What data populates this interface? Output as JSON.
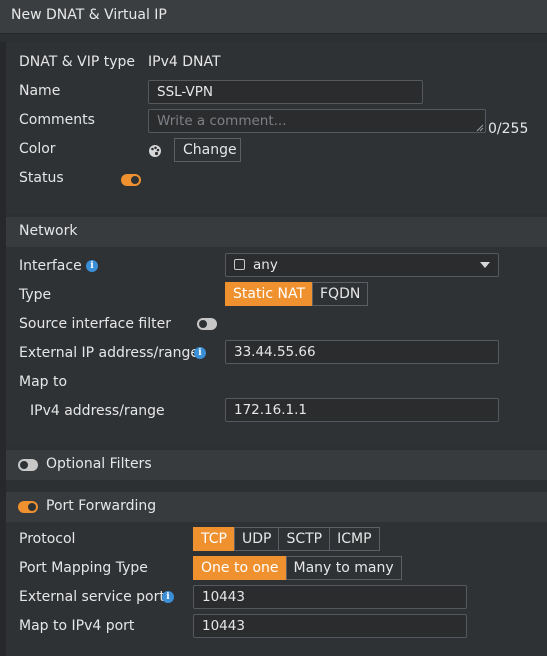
{
  "dialog": {
    "title": "New DNAT & Virtual IP"
  },
  "general": {
    "type_label": "DNAT & VIP type",
    "type_value": "IPv4 DNAT",
    "name_label": "Name",
    "name_value": "SSL-VPN",
    "comments_label": "Comments",
    "comments_placeholder": "Write a comment...",
    "comments_counter": "0/255",
    "color_label": "Color",
    "color_button": "Change",
    "status_label": "Status",
    "status_on": true
  },
  "network": {
    "heading": "Network",
    "interface_label": "Interface",
    "interface_value": "any",
    "type_label": "Type",
    "type_options": [
      "Static NAT",
      "FQDN"
    ],
    "type_selected": "Static NAT",
    "source_filter_label": "Source interface filter",
    "source_filter_on": false,
    "external_ip_label": "External IP address/range",
    "external_ip_value": "33.44.55.66",
    "map_to_label": "Map to",
    "ipv4_range_label": "IPv4 address/range",
    "ipv4_range_value": "172.16.1.1"
  },
  "optional_filters": {
    "label": "Optional Filters",
    "on": false
  },
  "port_forwarding": {
    "label": "Port Forwarding",
    "on": true,
    "protocol_label": "Protocol",
    "protocol_options": [
      "TCP",
      "UDP",
      "SCTP",
      "ICMP"
    ],
    "protocol_selected": "TCP",
    "mapping_type_label": "Port Mapping Type",
    "mapping_type_options": [
      "One to one",
      "Many to many"
    ],
    "mapping_type_selected": "One to one",
    "external_port_label": "External service port",
    "external_port_value": "10443",
    "map_port_label": "Map to IPv4 port",
    "map_port_value": "10443"
  },
  "colors": {
    "accent": "#f0912f",
    "info": "#3a8fd6",
    "background": "#2f3235"
  }
}
